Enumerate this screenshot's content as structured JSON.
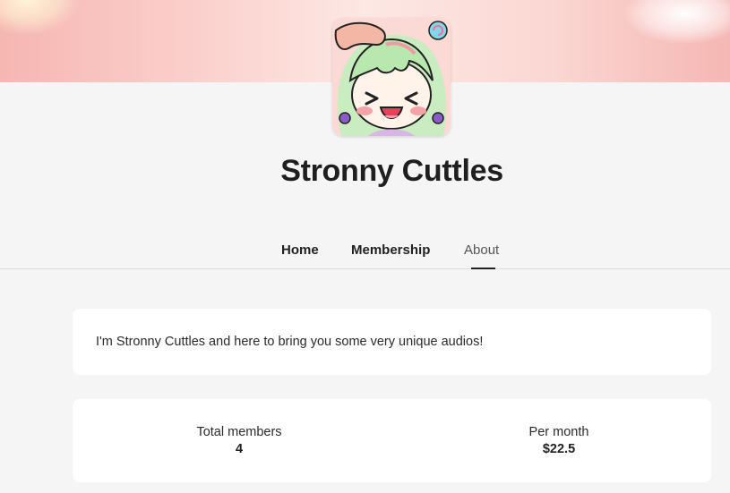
{
  "creator": {
    "name": "Stronny Cuttles",
    "avatar_icon": "anime-girl-avatar-icon"
  },
  "nav": {
    "tabs": [
      {
        "label": "Home",
        "active": false
      },
      {
        "label": "Membership",
        "active": false
      },
      {
        "label": "About",
        "active": true
      }
    ]
  },
  "about": {
    "text": "I'm Stronny Cuttles and here to bring you some very unique audios!"
  },
  "stats": {
    "members_label": "Total members",
    "members_value": "4",
    "per_month_label": "Per month",
    "per_month_value": "$22.5"
  },
  "colors": {
    "background": "#f5f5f5",
    "banner_pink": "#f6b6b2",
    "card": "#ffffff",
    "text": "#222222"
  }
}
